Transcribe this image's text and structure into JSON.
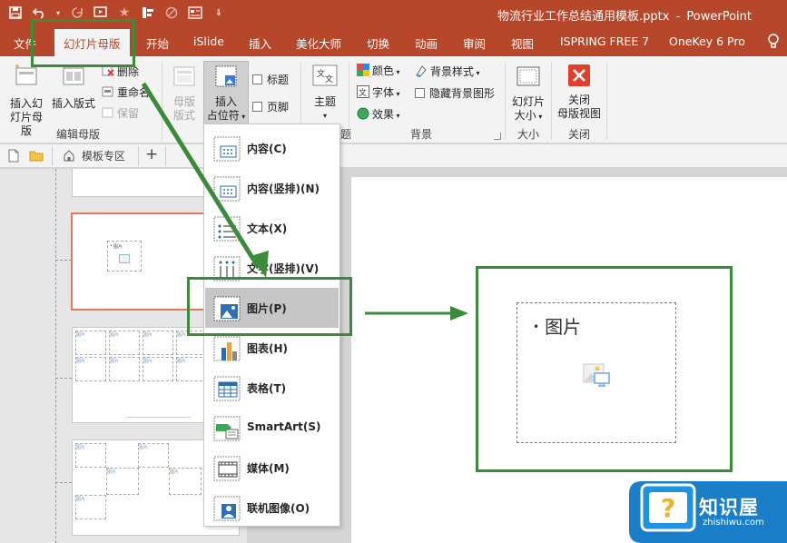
{
  "window": {
    "filename": "物流行业工作总结通用模板.pptx",
    "separator": "-",
    "app": "PowerPoint"
  },
  "qat": {
    "icons": [
      "save-icon",
      "undo-icon",
      "redo-icon",
      "slideshow-icon",
      "star-icon",
      "insert-icon",
      "link-icon",
      "form-icon",
      "customize-icon"
    ]
  },
  "tabs": {
    "file": "文件",
    "slide_master": "幻灯片母版",
    "home": "开始",
    "islide": "iSlide",
    "insert": "插入",
    "beautify": "美化大师",
    "transitions": "切换",
    "animations": "动画",
    "review": "审阅",
    "view": "视图",
    "ispring": "ISPRING FREE 7",
    "onekey": "OneKey 6 Pro"
  },
  "ribbon": {
    "insert_master": [
      "插入幻",
      "灯片母版"
    ],
    "insert_layout": "插入版式",
    "delete": "删除",
    "rename": "重命名",
    "preserve": "保留",
    "group_edit_master": "编辑母版",
    "master_layout": [
      "母版",
      "版式"
    ],
    "insert_placeholder": [
      "插入",
      "占位符"
    ],
    "title_check": "标题",
    "footer_check": "页脚",
    "theme": "主题",
    "group_theme_tail": "题",
    "colors": "颜色",
    "fonts": "字体",
    "effects": "效果",
    "bg_styles": "背景样式",
    "hide_bg": "隐藏背景图形",
    "group_background": "背景",
    "slide_size": [
      "幻灯片",
      "大小"
    ],
    "group_size": "大小",
    "close_master": [
      "关闭",
      "母版视图"
    ],
    "group_close": "关闭",
    "accent": "#b7472a"
  },
  "pane_tabs": {
    "templates": "模板专区",
    "add": "+"
  },
  "dropdown": {
    "items": [
      {
        "label": "内容(C)",
        "icon": "content-placeholder-icon"
      },
      {
        "label": "内容(竖排)(N)",
        "icon": "content-vertical-placeholder-icon"
      },
      {
        "label": "文本(X)",
        "icon": "text-placeholder-icon"
      },
      {
        "label": "文字(竖排)(V)",
        "icon": "text-vertical-placeholder-icon"
      },
      {
        "label": "图片(P)",
        "icon": "picture-placeholder-icon"
      },
      {
        "label": "图表(H)",
        "icon": "chart-placeholder-icon"
      },
      {
        "label": "表格(T)",
        "icon": "table-placeholder-icon"
      },
      {
        "label": "SmartArt(S)",
        "icon": "smartart-placeholder-icon"
      },
      {
        "label": "媒体(M)",
        "icon": "media-placeholder-icon"
      },
      {
        "label": "联机图像(O)",
        "icon": "online-image-placeholder-icon"
      }
    ],
    "hovered": "图片(P)"
  },
  "thumbnails": {
    "placeholder_label": "图片",
    "bullet": "•"
  },
  "slide": {
    "placeholder_text": "图片",
    "bullet": "•"
  },
  "watermark": {
    "name": "知识屋",
    "url": "zhishiwu.com",
    "color": "#1a7fc8"
  },
  "annotation_color": "#3a8c3a"
}
